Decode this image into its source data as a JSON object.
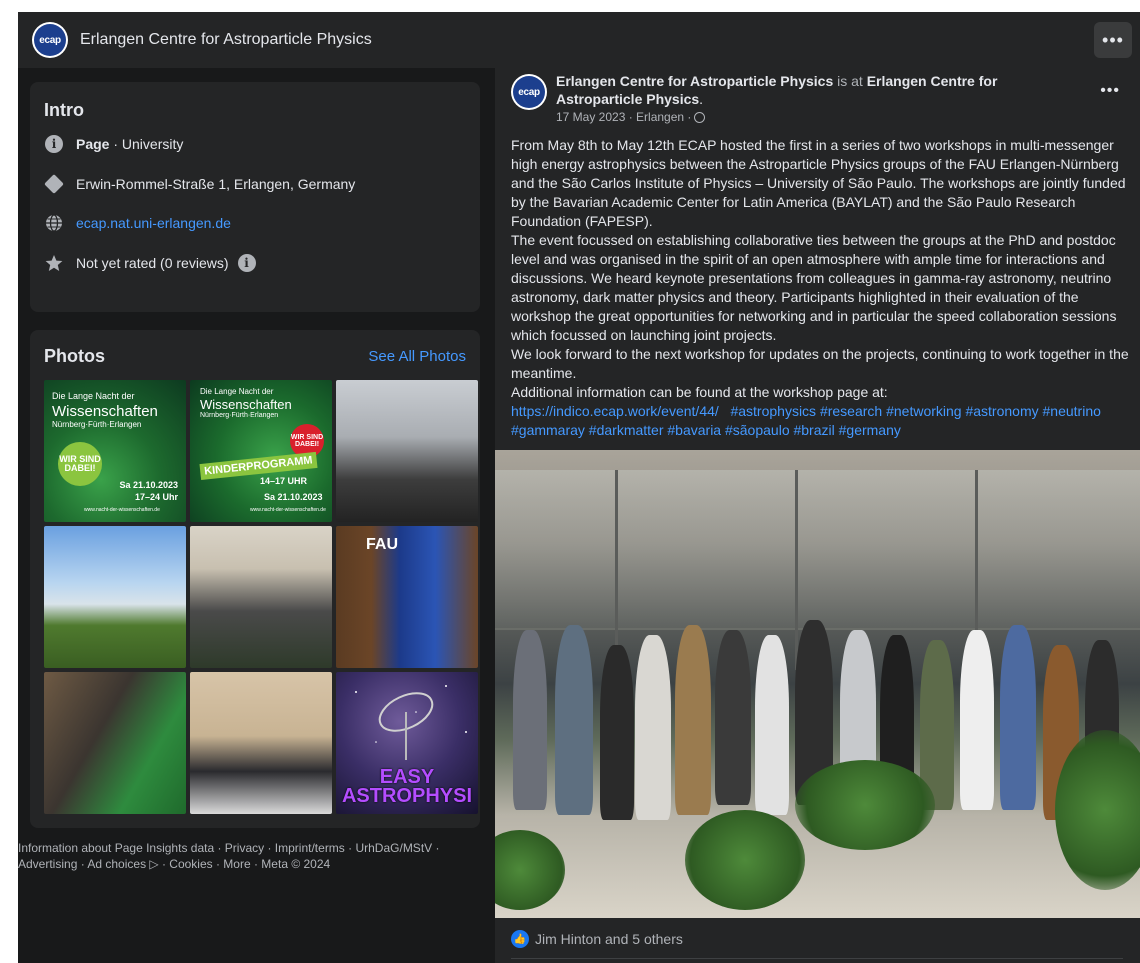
{
  "header": {
    "logo_text": "ecap",
    "page_name": "Erlangen Centre for Astroparticle Physics",
    "more_label": "•••"
  },
  "intro": {
    "title": "Intro",
    "category_bold": "Page",
    "category_rest": " · University",
    "address": "Erwin-Rommel-Straße 1, Erlangen, Germany",
    "website": "ecap.nat.uni-erlangen.de",
    "rating": "Not yet rated (0 reviews)",
    "icons": [
      "info-icon",
      "address-diamond-icon",
      "globe-icon",
      "star-icon",
      "info-icon"
    ]
  },
  "photos": {
    "title": "Photos",
    "see_all": "See All Photos",
    "tiles": [
      {
        "line1": "Die Lange Nacht der",
        "line2": "Wissenschaften",
        "line3": "Nürnberg·Fürth·Erlangen",
        "badge": "WIR SIND DABEI!",
        "date": "Sa 21.10.2023",
        "time": "17–24 Uhr",
        "url": "www.nacht-der-wissenschaften.de"
      },
      {
        "line1": "Die Lange Nacht der",
        "line2": "Wissenschaften",
        "line3": "Nürnberg·Fürth·Erlangen",
        "badge": "WIR SIND DABEI!",
        "program": "KINDERPROGRAMM",
        "program_time": "14–17 UHR",
        "date": "Sa 21.10.2023",
        "url": "www.nacht-der-wissenschaften.de"
      },
      {
        "caption": ""
      },
      {
        "caption": ""
      },
      {
        "caption": ""
      },
      {
        "logo": "FAU"
      },
      {
        "caption": ""
      },
      {
        "caption": ""
      },
      {
        "text": "EASY ASTROPHYSI"
      }
    ]
  },
  "footer": {
    "text": "Information about Page Insights data · Privacy · Imprint/terms · UrhDaG/MStV · Advertising · Ad choices ▷ · Cookies · More · Meta © 2024"
  },
  "post": {
    "author": "Erlangen Centre for Astroparticle Physics",
    "is_at": " is at ",
    "location": "Erlangen Centre for Astroparticle Physics",
    "date": "17 May 2023 · Erlangen ·",
    "more_label": "•••",
    "paragraphs": [
      "From May 8th to May 12th ECAP hosted the first in a series of two workshops in multi-messenger high energy astrophysics between the Astroparticle Physics groups of the FAU Erlangen-Nürnberg and the São Carlos Institute of Physics – University of São Paulo. The workshops are jointly funded by the Bavarian Academic Center for Latin America (BAYLAT) and the São Paulo Research Foundation (FAPESP).",
      "The event focussed on establishing collaborative ties between the groups at the PhD and postdoc level and was organised in the spirit of an open atmosphere with ample time for interactions and discussions. We heard keynote presentations from colleagues in gamma-ray astronomy, neutrino astronomy, dark matter physics and theory. Participants highlighted in their evaluation of the workshop the great opportunities for networking and in particular the speed collaboration sessions which focussed on launching joint projects.",
      "We look forward to the next workshop for updates on the projects, continuing to work together in the meantime.",
      "Additional information can be found at the workshop page at:"
    ],
    "link": "https://indico.ecap.work/event/44/",
    "hashtags": "#astrophysics #research #networking #astronomy #neutrino #gammaray #darkmatter #bavaria #sãopaulo #brazil #germany",
    "reactions": "Jim Hinton and 5 others"
  }
}
